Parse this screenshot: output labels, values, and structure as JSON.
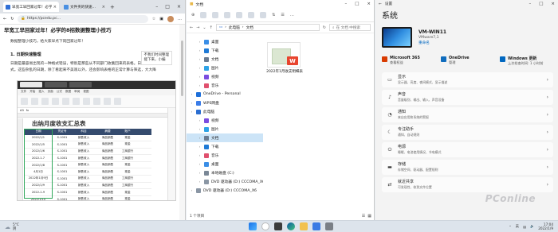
{
  "edge": {
    "tab_active": "早宽工早回家过年！必学的8招数据整理小...",
    "tab_inactive": "文件夹的快速...",
    "url": "https://pcedu.pc...",
    "article": {
      "title": "早宽工早回家过年！必学的8招数据整理小技巧",
      "intro": "数据整理小技巧，给大家早点下岗回家过年！",
      "tooltip_line1": "不我们时间整理",
      "tooltip_line2": "能下来，小编",
      "heading": "1. 日期快速整理",
      "para1": "日期是最容易出现的一种格式错误，特别是那些从不同部门收集回来的表格。日期",
      "para2": "式。这些杂乱的日期，除了看起来不美观以外，还会影响表格的正常计算与筛选，大大降"
    },
    "sheet": {
      "title": "出纳月度收支汇总表",
      "headers": [
        "日期",
        "凭证号",
        "科目",
        "摘要",
        "账户"
      ],
      "rows": [
        [
          "2022/1/1",
          "S-1001",
          "销售收入",
          "商品销售",
          "现金"
        ],
        [
          "2022/1/5",
          "S-1001",
          "销售收入",
          "商品销售",
          "现金"
        ],
        [
          "2022/1/6",
          "S-1001",
          "销售收入",
          "商品销售",
          "工商银行"
        ],
        [
          "2022.1.7",
          "S-1001",
          "销售收入",
          "商品销售",
          "工商银行"
        ],
        [
          "2022/1/8",
          "S-1001",
          "销售收入",
          "商品销售",
          "现金"
        ],
        [
          "4月1日",
          "S-1001",
          "销售收入",
          "商品销售",
          "现金"
        ],
        [
          "2022年1月9日",
          "S-1001",
          "销售收入",
          "商品销售",
          "工商银行"
        ],
        [
          "2022/1/9",
          "S-1001",
          "销售收入",
          "商品销售",
          "工商银行"
        ],
        [
          "2022-1-9",
          "S-1001",
          "销售收入",
          "商品销售",
          "现金"
        ],
        [
          "2022/1/10",
          "S-1001",
          "销售收入",
          "商品销售",
          "现金"
        ]
      ]
    }
  },
  "explorer": {
    "title": "文档",
    "path": [
      "此电脑",
      "文档"
    ],
    "search_placeholder": "在 文档 中搜索",
    "sidebar": [
      {
        "label": "桌面",
        "color": "#3a8ee6",
        "indent": 1
      },
      {
        "label": "下载",
        "color": "#1f7ad6",
        "indent": 1
      },
      {
        "label": "文档",
        "color": "#6b7b90",
        "indent": 1
      },
      {
        "label": "图片",
        "color": "#2ea3e6",
        "indent": 1
      },
      {
        "label": "视频",
        "color": "#7b4de0",
        "indent": 1
      },
      {
        "label": "音乐",
        "color": "#e0506e",
        "indent": 1
      },
      {
        "label": "OneDrive - Personal",
        "color": "#1e6fd9",
        "indent": 0
      },
      {
        "label": "WPS网盘",
        "color": "#3b7de8",
        "indent": 0
      },
      {
        "label": "此电脑",
        "color": "#2b6ed1",
        "indent": 0
      },
      {
        "label": "视频",
        "color": "#7b4de0",
        "indent": 1
      },
      {
        "label": "图片",
        "color": "#2ea3e6",
        "indent": 1
      },
      {
        "label": "文档",
        "color": "#6b7b90",
        "indent": 1,
        "selected": true
      },
      {
        "label": "下载",
        "color": "#1f7ad6",
        "indent": 1
      },
      {
        "label": "音乐",
        "color": "#e0506e",
        "indent": 1
      },
      {
        "label": "桌面",
        "color": "#3a8ee6",
        "indent": 1
      },
      {
        "label": "本地磁盘 (C:)",
        "color": "#7a8796",
        "indent": 1
      },
      {
        "label": "DVD 驱动器 (D:) CCCOMA_X6",
        "color": "#8a96a4",
        "indent": 1
      },
      {
        "label": "DVD 驱动器 (D:) CCCOMA_X6",
        "color": "#8a96a4",
        "indent": 0
      }
    ],
    "file_name": "2022年1月收支明细表",
    "file_badge": "W",
    "status": "1 个项目"
  },
  "settings": {
    "app_title": "设置",
    "heading": "系统",
    "device_name": "VM-WIN11",
    "device_model": "VMware7,1",
    "rename": "重命名",
    "quick": [
      {
        "name": "Microsoft 365",
        "sub": "查看权益",
        "color": "#d83b01"
      },
      {
        "name": "OneDrive",
        "sub": "管理",
        "color": "#0f6cbd"
      },
      {
        "name": "Windows 更新",
        "sub": "上次检查时间: 1 小时前",
        "color": "#0067c0"
      }
    ],
    "items": [
      {
        "name": "显示",
        "sub": "显示器、亮度、夜间模式、显示描述",
        "icon": "▭"
      },
      {
        "name": "声音",
        "sub": "音量级别、输出、输入、声音设备",
        "icon": "♪"
      },
      {
        "name": "通知",
        "sub": "来自应用和系统的警报",
        "icon": "◔"
      },
      {
        "name": "专注助手",
        "sub": "通知、自动规则",
        "icon": "☾"
      },
      {
        "name": "电源",
        "sub": "睡眠、电池使用情况、节电模式",
        "icon": "⏻"
      },
      {
        "name": "存储",
        "sub": "存储空间、驱动器、配置规则",
        "icon": "▬"
      },
      {
        "name": "就近共享",
        "sub": "可发现性、收到文件位置",
        "icon": "⇄"
      }
    ],
    "watermark": "PConline"
  },
  "taskbar": {
    "weather_temp": "5°C",
    "weather_text": "阴",
    "time": "17:04",
    "date": "2022/1/9",
    "ime": "英"
  }
}
